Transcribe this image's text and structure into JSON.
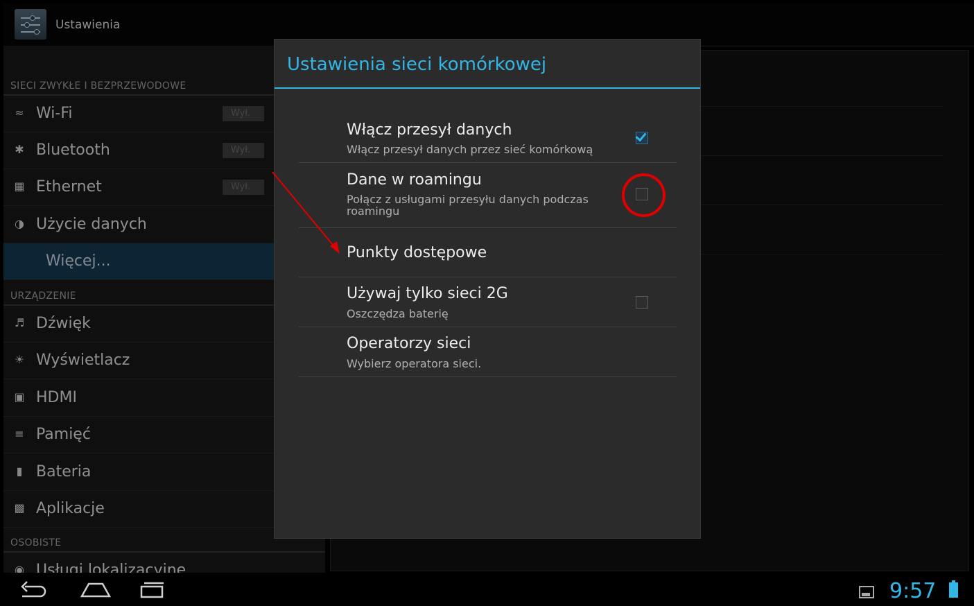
{
  "app": {
    "title": "Ustawienia"
  },
  "settings": {
    "sections": [
      {
        "header": "SIECI ZWYKŁE I BEZPRZEWODOWE"
      },
      {
        "header": "URZĄDZENIE"
      },
      {
        "header": "OSOBISTE"
      }
    ],
    "items": [
      {
        "label": "Wi-Fi",
        "toggle": "Wył.",
        "icon": "wifi-icon"
      },
      {
        "label": "Bluetooth",
        "toggle": "Wył.",
        "icon": "bluetooth-icon"
      },
      {
        "label": "Ethernet",
        "toggle": "Wył.",
        "icon": "ethernet-icon"
      },
      {
        "label": "Użycie danych",
        "icon": "data-usage-icon"
      },
      {
        "label": "Więcej...",
        "selected": true
      },
      {
        "label": "Dźwięk",
        "icon": "speaker-icon"
      },
      {
        "label": "Wyświetlacz",
        "icon": "display-icon"
      },
      {
        "label": "HDMI",
        "icon": "hdmi-icon"
      },
      {
        "label": "Pamięć",
        "icon": "storage-icon"
      },
      {
        "label": "Bateria",
        "icon": "battery-icon"
      },
      {
        "label": "Aplikacje",
        "icon": "apps-icon"
      },
      {
        "label": "Usługi lokalizacyjne",
        "icon": "location-icon"
      }
    ]
  },
  "dialog": {
    "title": "Ustawienia sieci komórkowej",
    "prefs": [
      {
        "title": "Włącz przesył danych",
        "summary": "Włącz przesył danych przez sieć komórkową",
        "checkbox": true,
        "checked": true
      },
      {
        "title": "Dane w roamingu",
        "summary": "Połącz z usługami przesyłu danych podczas roamingu",
        "checkbox": true,
        "checked": false
      },
      {
        "title": "Punkty dostępowe",
        "summary": ""
      },
      {
        "title": "Używaj tylko sieci 2G",
        "summary": "Oszczędza baterię",
        "checkbox": true,
        "checked": false
      },
      {
        "title": "Operatorzy sieci",
        "summary": "Wybierz operatora sieci."
      }
    ]
  },
  "status": {
    "time": "9:57"
  },
  "colors": {
    "accent": "#33b5e5",
    "annotation": "#e00000"
  }
}
